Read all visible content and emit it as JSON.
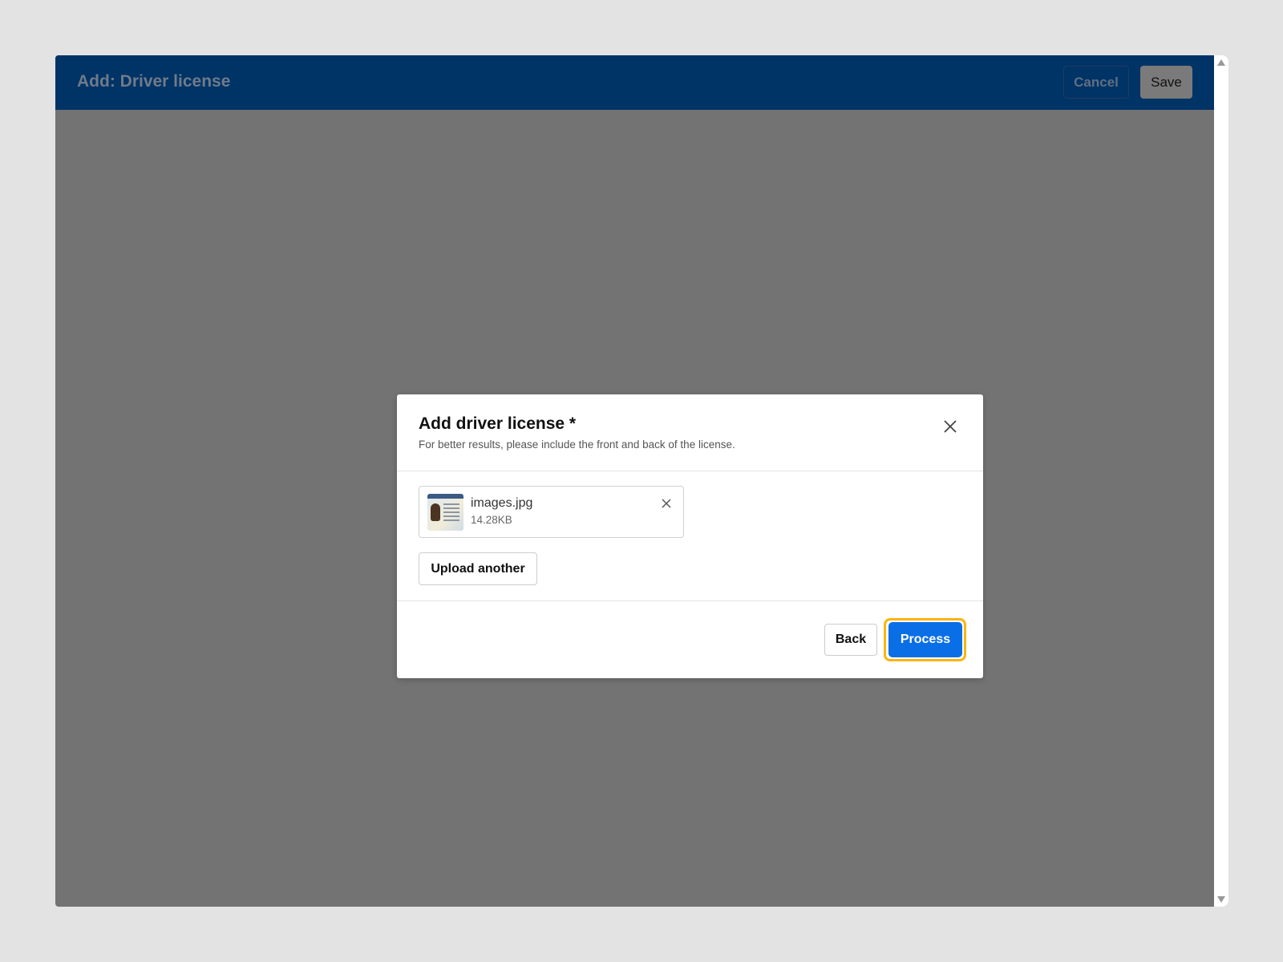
{
  "header": {
    "title": "Add: Driver license",
    "cancel_label": "Cancel",
    "save_label": "Save"
  },
  "modal": {
    "title": "Add driver license *",
    "subtitle": "For better results, please include the front and back of the license.",
    "file": {
      "name": "images.jpg",
      "size": "14.28KB"
    },
    "upload_another_label": "Upload another",
    "back_label": "Back",
    "process_label": "Process"
  },
  "colors": {
    "header_bg": "#003366",
    "primary": "#0a6fe6",
    "focus_ring": "#fbb40f",
    "overlay": "#737373"
  },
  "icons": {
    "close": "close-icon",
    "remove_file": "close-icon",
    "scroll_up": "triangle-up-icon",
    "scroll_down": "triangle-down-icon"
  }
}
